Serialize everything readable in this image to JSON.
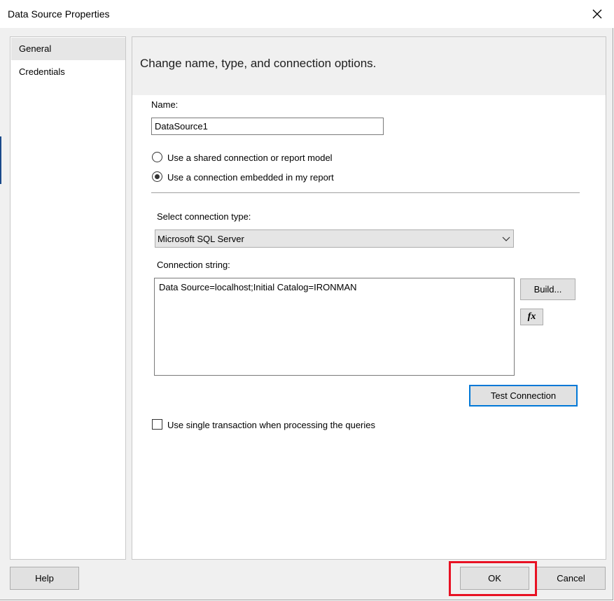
{
  "window": {
    "title": "Data Source Properties",
    "close_glyph": "✕"
  },
  "nav": {
    "items": [
      {
        "label": "General",
        "selected": true
      },
      {
        "label": "Credentials",
        "selected": false
      }
    ]
  },
  "content": {
    "header": "Change name, type, and connection options.",
    "name_label": "Name:",
    "name_value": "DataSource1",
    "radio_shared": "Use a shared connection or report model",
    "radio_embedded": "Use a connection embedded in my report",
    "selected_radio": "embedded",
    "connection_type_label": "Select connection type:",
    "connection_type_value": "Microsoft SQL Server",
    "connection_string_label": "Connection string:",
    "connection_string_value": "Data Source=localhost;Initial Catalog=IRONMAN",
    "build_button": "Build...",
    "fx_button": "fx",
    "test_connection_button": "Test Connection",
    "single_transaction_label": "Use single transaction when processing the queries",
    "single_transaction_checked": false
  },
  "footer": {
    "help_button": "Help",
    "ok_button": "OK",
    "cancel_button": "Cancel"
  },
  "colors": {
    "highlight": "#e81123",
    "focus": "#0078d7"
  }
}
